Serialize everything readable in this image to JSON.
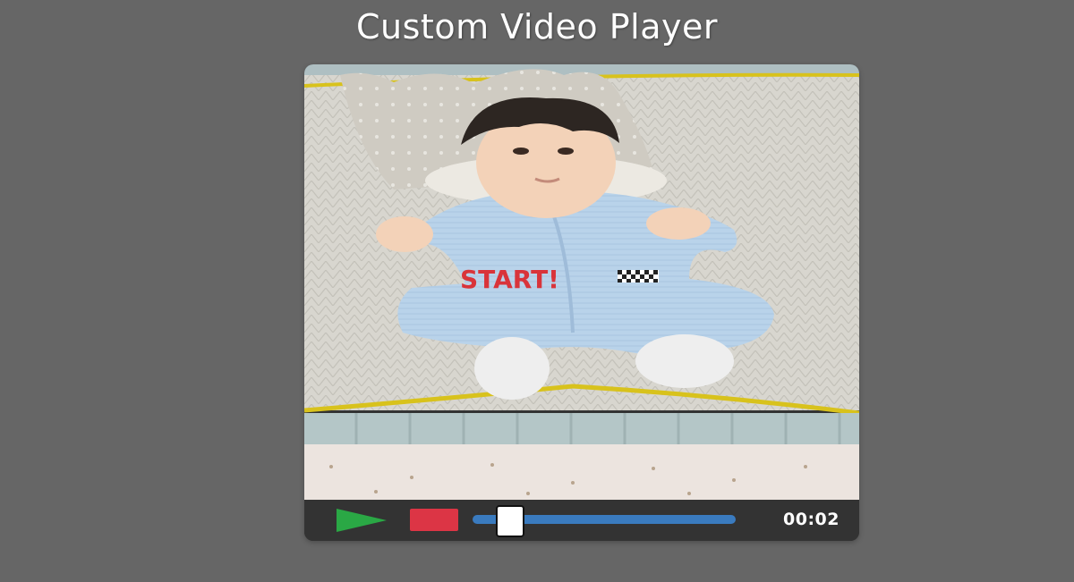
{
  "page": {
    "title": "Custom Video Player"
  },
  "video": {
    "overlay_text": "START!"
  },
  "controls": {
    "play_icon": "play-icon",
    "stop_icon": "stop-icon",
    "timestamp": "00:02",
    "progress_fraction": 0.1
  },
  "colors": {
    "background": "#666666",
    "play": "#2aa845",
    "stop": "#dc3545",
    "progress": "#3a7bbf",
    "controls_bar": "#333333"
  }
}
